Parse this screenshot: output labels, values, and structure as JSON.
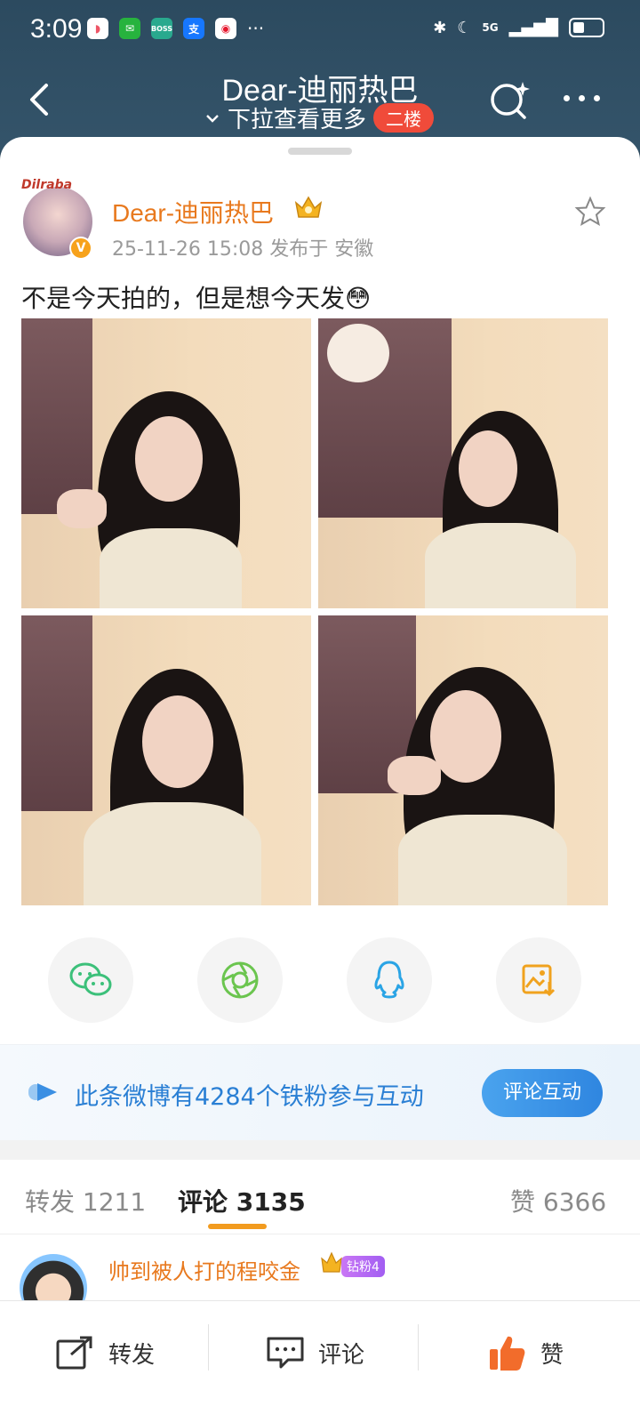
{
  "status_bar": {
    "time": "3:09",
    "more": "···",
    "network": "5G"
  },
  "header": {
    "title": "Dear-迪丽热巴",
    "subtitle": "下拉查看更多",
    "floor_badge": "二楼"
  },
  "post": {
    "username": "Dear-迪丽热巴",
    "avatar_tag": "Dilraba",
    "verify_mark": "V",
    "meta": "25-11-26 15:08  发布于 安徽",
    "text": "不是今天拍的，但是想今天发"
  },
  "share": {
    "icons": [
      "wechat-icon",
      "moments-icon",
      "qq-icon",
      "save-image-icon"
    ]
  },
  "fan_banner": {
    "text": "此条微博有4284个铁粉参与互动",
    "button": "评论互动"
  },
  "tabs": {
    "repost": "转发 1211",
    "comment": "评论 3135",
    "like": "赞 6366"
  },
  "comment": {
    "name": "帅到被人打的程咬金",
    "badge": "钻粉4"
  },
  "bottom_bar": {
    "repost": "转发",
    "comment": "评论",
    "like": "赞"
  },
  "colors": {
    "header_bg": "#2c4a5f",
    "accent_orange": "#e8791e",
    "link_blue": "#2a7fd4",
    "floor_badge": "#f04b3a",
    "tab_indicator": "#f29b1f"
  }
}
